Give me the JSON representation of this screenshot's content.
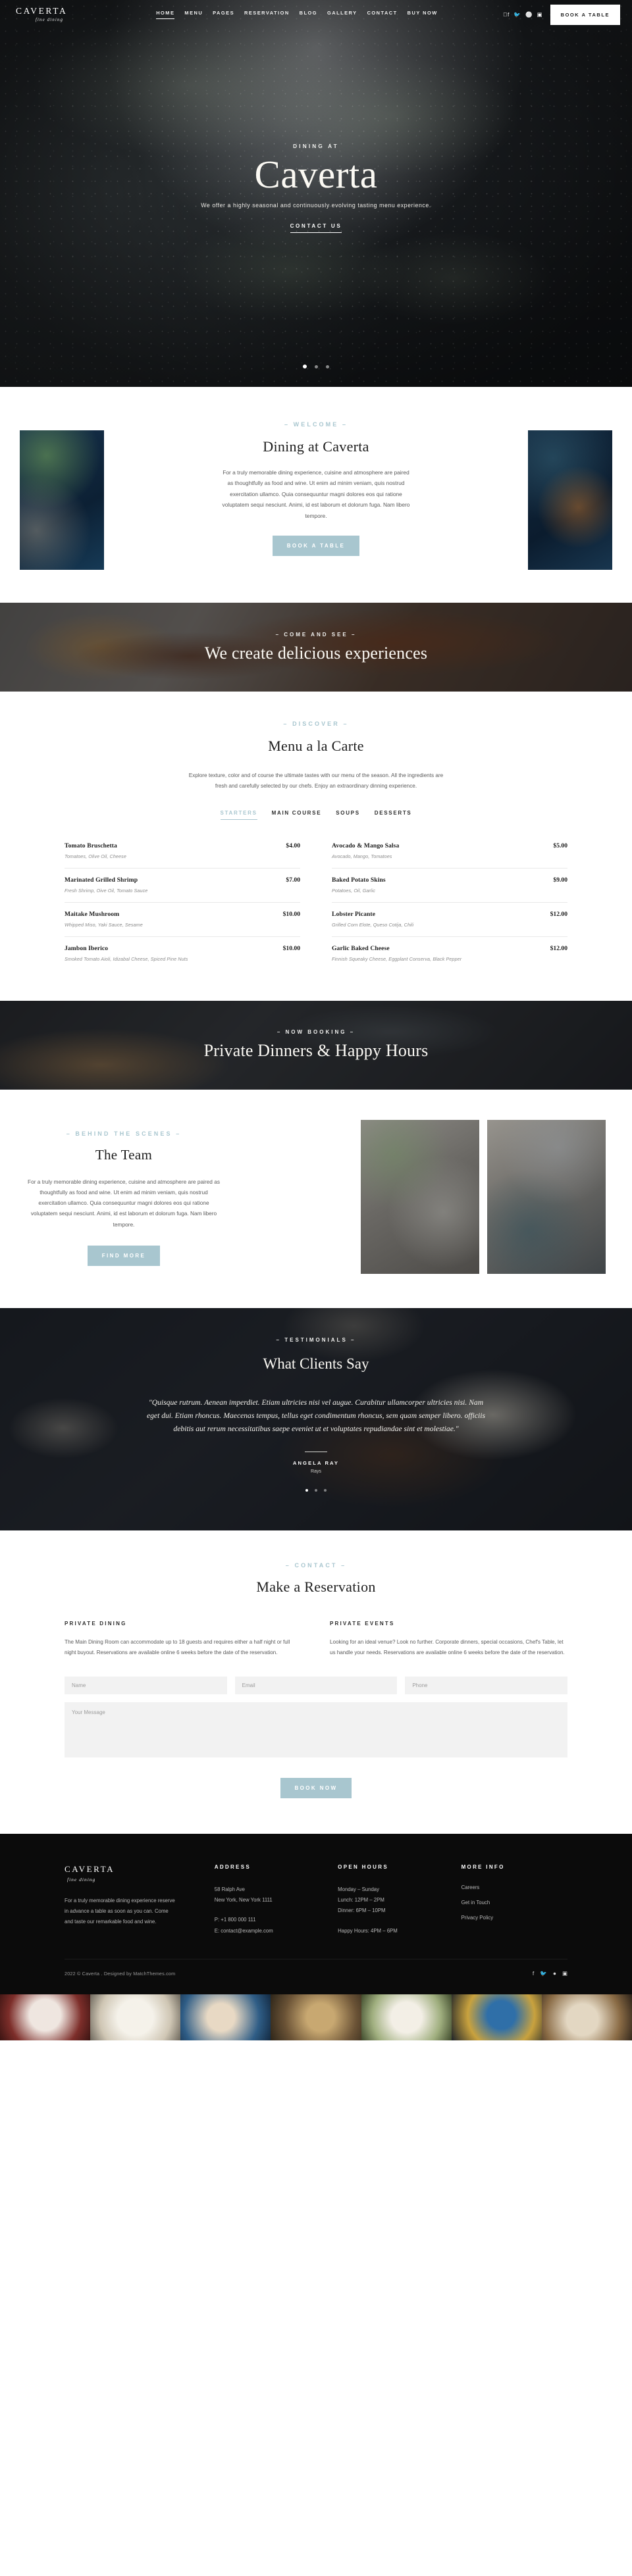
{
  "nav": {
    "brand_name": "CAVERTA",
    "brand_tagline": "fine dining",
    "links": [
      "HOME",
      "MENU",
      "PAGES",
      "RESERVATION",
      "BLOG",
      "GALLERY",
      "CONTACT",
      "BUY NOW"
    ],
    "active_link": "HOME",
    "social": [
      "facebook-icon",
      "twitter-icon",
      "pinterest-icon",
      "instagram-icon"
    ],
    "book_label": "BOOK A TABLE"
  },
  "hero": {
    "eyebrow": "DINING AT",
    "title": "Caverta",
    "subtitle": "We offer a highly seasonal and continuously evolving tasting menu experience.",
    "cta": "CONTACT US",
    "dots": 3,
    "active_dot": 1
  },
  "welcome": {
    "eyebrow": "– WELCOME –",
    "title": "Dining at Caverta",
    "text": "For a truly memorable dining experience, cuisine and atmosphere are paired as thoughtfully as food and wine. Ut enim ad minim veniam, quis nostrud exercitation ullamco. Quia consequuntur magni dolores eos qui ratione voluptatem sequi nesciunt. Animi, id est laborum et dolorum fuga. Nam libero tempore.",
    "button": "BOOK A TABLE"
  },
  "banner_cocoa": {
    "eyebrow": "– COME AND SEE –",
    "title": "We create delicious experiences"
  },
  "menu": {
    "eyebrow": "– DISCOVER –",
    "title": "Menu a la Carte",
    "description": "Explore texture, color and of course the ultimate tastes with our menu of the season. All the ingredients are fresh and carefully selected by our chefs. Enjoy an extraordinary dinning experience.",
    "tabs": [
      "STARTERS",
      "MAIN COURSE",
      "SOUPS",
      "DESSERTS"
    ],
    "active_tab": "STARTERS",
    "items_left": [
      {
        "name": "Tomato Bruschetta",
        "price": "$4.00",
        "desc": "Tomatoes, Olive Oil, Cheese"
      },
      {
        "name": "Marinated Grilled Shrimp",
        "price": "$7.00",
        "desc": "Fresh Shrimp, Oive Oil, Tomato Sauce"
      },
      {
        "name": "Maitake Mushroom",
        "price": "$10.00",
        "desc": "Whipped Miso, Yaki Sauce, Sesame"
      },
      {
        "name": "Jambon Iberico",
        "price": "$10.00",
        "desc": "Smoked Tomato Aioli, Idizabal Cheese, Spiced Pine Nuts"
      }
    ],
    "items_right": [
      {
        "name": "Avocado & Mango Salsa",
        "price": "$5.00",
        "desc": "Avocado, Mango, Tomatoes"
      },
      {
        "name": "Baked Potato Skins",
        "price": "$9.00",
        "desc": "Potatoes, Oil, Garlic"
      },
      {
        "name": "Lobster Picante",
        "price": "$12.00",
        "desc": "Grilled Corn Elote, Queso Cotija, Chili"
      },
      {
        "name": "Garlic Baked Cheese",
        "price": "$12.00",
        "desc": "Finnish Squeaky Cheese, Eggplant Conserva, Black Pepper"
      }
    ]
  },
  "banner_dining": {
    "eyebrow": "– NOW BOOKING –",
    "title": "Private Dinners & Happy Hours"
  },
  "team": {
    "eyebrow": "– BEHIND THE SCENES –",
    "title": "The Team",
    "text": "For a truly memorable dining experience, cuisine and atmosphere are paired as thoughtfully as food and wine. Ut enim ad minim veniam, quis nostrud exercitation ullamco. Quia consequuntur magni dolores eos qui ratione voluptatem sequi nesciunt. Animi, id est laborum et dolorum fuga. Nam libero tempore.",
    "button": "FIND MORE"
  },
  "testimonials": {
    "eyebrow": "– TESTIMONIALS –",
    "title": "What Clients Say",
    "quote": "\"Quisque rutrum. Aenean imperdiet. Etiam ultricies nisi vel augue. Curabitur ullamcorper ultricies nisi. Nam eget dui. Etiam rhoncus. Maecenas tempus, tellus eget condimentum rhoncus, sem quam semper libero. officiis debitis aut rerum necessitatibus saepe eveniet ut et voluptates repudiandae sint et molestiae.\"",
    "author": "ANGELA RAY",
    "role": "Rays",
    "dots": 3,
    "active_dot": 1
  },
  "reservation": {
    "eyebrow": "– CONTACT –",
    "title": "Make a Reservation",
    "col_left_heading": "PRIVATE DINING",
    "col_left_text": "The Main Dining Room can accommodate up to 18 guests and requires either a half night or full night buyout. Reservations are available online 6 weeks before the date of the reservation.",
    "col_right_heading": "PRIVATE EVENTS",
    "col_right_text": "Looking for an ideal venue? Look no further. Corporate dinners, special occasions, Chef's Table, let us handle your needs. Reservations are available online 6 weeks before the date of the reservation.",
    "placeholder_name": "Name",
    "placeholder_email": "Email",
    "placeholder_phone": "Phone",
    "placeholder_message": "Your Message",
    "submit_label": "BOOK NOW"
  },
  "footer": {
    "brand_name": "CAVERTA",
    "brand_tagline": "fine dining",
    "about": "For a truly memorable dining experience reserve in advance a table as soon as you can. Come and taste our remarkable food and wine.",
    "address_heading": "ADDRESS",
    "address_line1": "58 Ralph Ave",
    "address_line2": "New York, New York 1111",
    "phone": "P: +1 800 000 111",
    "email": "E: contact@example.com",
    "hours_heading": "OPEN HOURS",
    "hours_days": "Monday – Sunday",
    "hours_lunch": "Lunch: 12PM – 2PM",
    "hours_dinner": "Dinner: 6PM – 10PM",
    "hours_happy": "Happy Hours: 4PM – 6PM",
    "more_heading": "MORE INFO",
    "more_links": [
      "Careers",
      "Get in Touch",
      "Privacy Policy"
    ],
    "copyright": "2022 © Caverta . Designed by MatchThemes.com",
    "social": [
      "facebook-icon",
      "twitter-icon",
      "pinterest-icon",
      "instagram-icon"
    ]
  },
  "colors": {
    "accent": "#a8c6cf",
    "dark": "#0b0b0b",
    "text": "#2b2b2b",
    "muted": "#5a5a5a"
  }
}
